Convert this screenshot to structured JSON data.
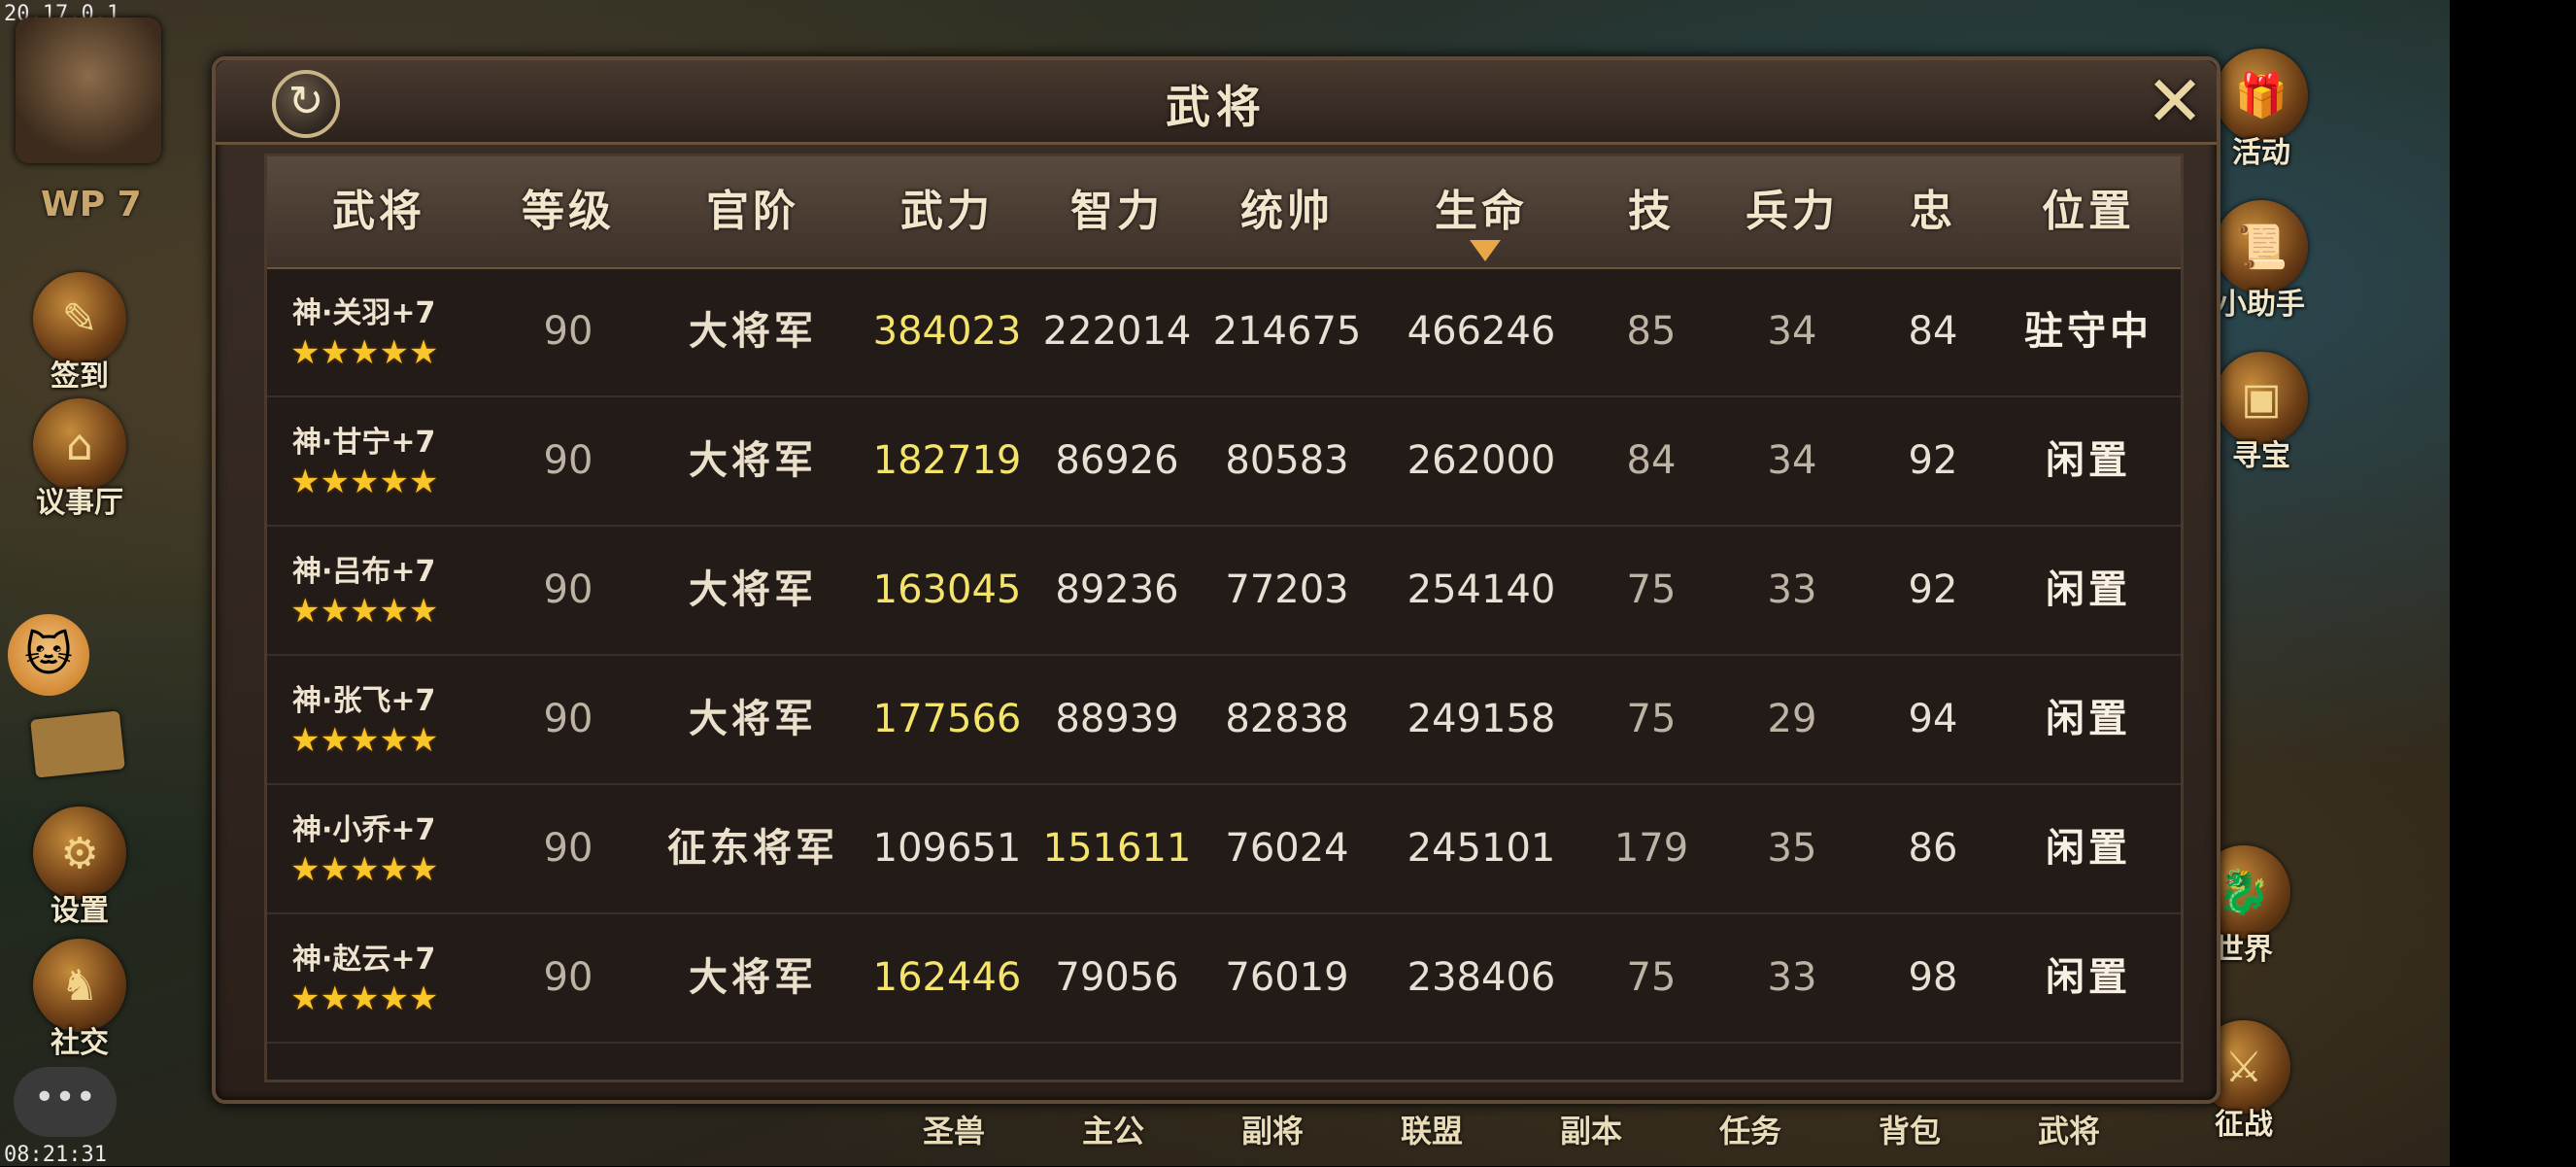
{
  "status": {
    "version": "20.17.0.1",
    "time": "08:21:31"
  },
  "hud": {
    "wp_label": "WP 7",
    "left_buttons": [
      {
        "label": "签到",
        "icon": "signin-icon"
      },
      {
        "label": "议事厅",
        "icon": "hall-icon"
      },
      {
        "label": "设置",
        "icon": "gear-icon"
      },
      {
        "label": "社交",
        "icon": "social-icon"
      }
    ],
    "right_buttons": [
      {
        "label": "活动",
        "icon": "gift-icon"
      },
      {
        "label": "小助手",
        "icon": "scroll-icon"
      },
      {
        "label": "寻宝",
        "icon": "chest-icon"
      },
      {
        "label": "世界",
        "icon": "dragon-icon"
      },
      {
        "label": "征战",
        "icon": "battle-icon"
      }
    ],
    "bottom_nav": [
      "圣兽",
      "主公",
      "副将",
      "联盟",
      "副本",
      "任务",
      "背包",
      "武将"
    ]
  },
  "panel": {
    "title": "武将",
    "refresh_symbol": "↻",
    "close_symbol": "✕",
    "columns": [
      "武将",
      "等级",
      "官阶",
      "武力",
      "智力",
      "统帅",
      "生命",
      "技",
      "兵力",
      "忠",
      "位置"
    ],
    "sort_column": "生命",
    "stars": "★★★★★",
    "rows": [
      {
        "name": "神·关羽+7",
        "level": "90",
        "rank": "大将军",
        "force": "384023",
        "intel": "222014",
        "command": "214675",
        "hp": "466246",
        "skill": "85",
        "troops": "34",
        "loyalty": "84",
        "position": "驻守中",
        "highlight": "force"
      },
      {
        "name": "神·甘宁+7",
        "level": "90",
        "rank": "大将军",
        "force": "182719",
        "intel": "86926",
        "command": "80583",
        "hp": "262000",
        "skill": "84",
        "troops": "34",
        "loyalty": "92",
        "position": "闲置",
        "highlight": "force"
      },
      {
        "name": "神·吕布+7",
        "level": "90",
        "rank": "大将军",
        "force": "163045",
        "intel": "89236",
        "command": "77203",
        "hp": "254140",
        "skill": "75",
        "troops": "33",
        "loyalty": "92",
        "position": "闲置",
        "highlight": "force"
      },
      {
        "name": "神·张飞+7",
        "level": "90",
        "rank": "大将军",
        "force": "177566",
        "intel": "88939",
        "command": "82838",
        "hp": "249158",
        "skill": "75",
        "troops": "29",
        "loyalty": "94",
        "position": "闲置",
        "highlight": "force"
      },
      {
        "name": "神·小乔+7",
        "level": "90",
        "rank": "征东将军",
        "force": "109651",
        "intel": "151611",
        "command": "76024",
        "hp": "245101",
        "skill": "179",
        "troops": "35",
        "loyalty": "86",
        "position": "闲置",
        "highlight": "intel"
      },
      {
        "name": "神·赵云+7",
        "level": "90",
        "rank": "大将军",
        "force": "162446",
        "intel": "79056",
        "command": "76019",
        "hp": "238406",
        "skill": "75",
        "troops": "33",
        "loyalty": "98",
        "position": "闲置",
        "highlight": "force"
      }
    ]
  }
}
